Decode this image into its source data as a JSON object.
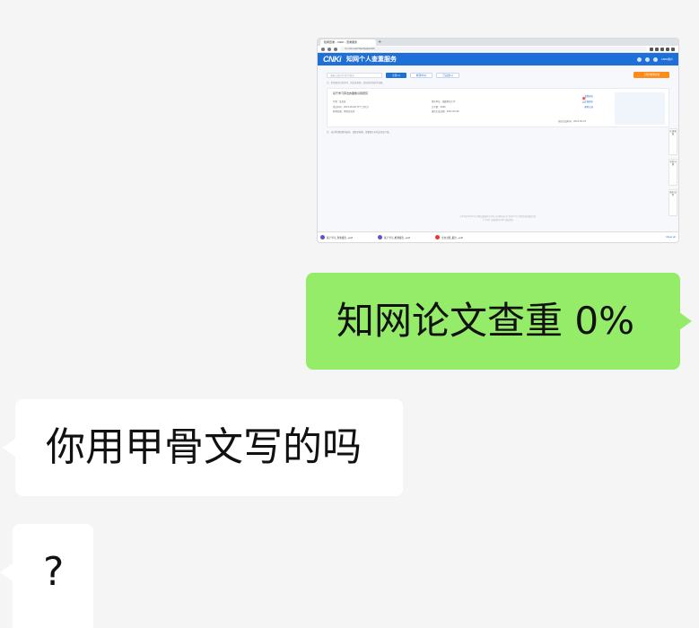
{
  "screenshot": {
    "browser_tabs": [
      "知网查重 - CNKI - 查重服务"
    ],
    "address": "cx.cnki.net/checkpaper/list",
    "logo": "CNKi",
    "site_title": "知网个人查重服务",
    "user_label": "CNKI用户",
    "search_placeholder": "请输入篇名/作者/关键词",
    "tabs": [
      "全部(1)",
      "检测中(0)",
      "已完成(1)"
    ],
    "upload_label": "上传待检测文档",
    "notice": "注：检测报告仅供参考，请妥善保管；如有疑问请联系客服。",
    "record": {
      "title": "基于学习算法的图像识别研究",
      "rows": [
        "作者：某某某",
        "所在单位：福建师范大学",
        "提交时间：2021-05-06 (5个工作日)",
        "文字数：5296",
        "检测范围：本地库全部",
        "报告生成日期：2021-05-06"
      ],
      "rate_label": "0%",
      "links": [
        "查看报告",
        "下载报告",
        "删除记录"
      ],
      "report_date": "报告生成时间：2021-05-07"
    },
    "footnote": "注：如对检测结果有疑问，请联系客服；查重报告可在此页面下载。",
    "side_buttons": [
      "在线客服",
      "常见问题",
      "服务说明"
    ],
    "footer_lines": [
      "京ICP证040431号 网络出版服务许可证 (总)网出证(京)字第271号 经营性网站备案信息",
      "© 2021 中国知网(CNKI) 版权所有"
    ],
    "downloads": [
      "基于学习_查重报告...pdf",
      "基于学习_检测报告...pdf",
      "全文对照_报告...pdf"
    ],
    "show_all": "Show all"
  },
  "messages": [
    {
      "side": "right",
      "text": "知网论文查重 0%"
    },
    {
      "side": "left",
      "text": "你用甲骨文写的吗"
    },
    {
      "side": "left",
      "text": "?"
    }
  ],
  "colors": {
    "chat_background": "#f5f5f5",
    "sent_bubble": "#95ec69",
    "received_bubble": "#ffffff",
    "cnki_blue": "#1f6fd8",
    "upload_orange": "#ff8b1a"
  }
}
